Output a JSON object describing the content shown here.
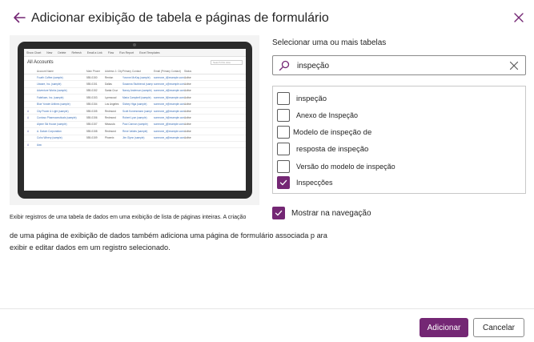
{
  "dialog": {
    "title": "Adicionar exibição de tabela e páginas de formulário"
  },
  "preview": {
    "toolbar": [
      "Show Chart",
      "New",
      "Delete",
      "Refresh",
      "Email a Link",
      "Flow",
      "Run Report",
      "Excel Templates"
    ],
    "view_name": "All Accounts",
    "search_placeholder": "Search this view",
    "columns": [
      "",
      "Account Name",
      "Main Phone",
      "Address 1: City",
      "Primary Contact",
      "Email (Primary Contact)",
      "Status"
    ],
    "rows": [
      [
        "",
        "Fourth Coffee (sample)",
        "555-0150",
        "Renton",
        "Yvonne McKay (sample)",
        "someone_i@example.com",
        "Active"
      ],
      [
        "",
        "Litware, Inc. (sample)",
        "555-0151",
        "Dallas",
        "Susanna Stubberod (samp",
        "someone_c@example.com",
        "Active"
      ],
      [
        "",
        "Adventure Works (sample)",
        "555-0152",
        "Santa Cruz",
        "Nancy Anderson (sample)",
        "someone_d@example.com",
        "Active"
      ],
      [
        "",
        "Fabrikam, Inc. (sample)",
        "555-0153",
        "Lynnwood",
        "Maria Campbell (sample)",
        "someone_f@example.com",
        "Active"
      ],
      [
        "",
        "Blue Yonder Airlines (sample)",
        "555-0154",
        "Los Angeles",
        "Sidney Higa (sample)",
        "someone_e@example.com",
        "Active"
      ],
      [
        "A",
        "City Power & Light (sample)",
        "555-0155",
        "Redmond",
        "Scott Konersmann (sampl",
        "someone_g@example.com",
        "Active"
      ],
      [
        "A",
        "Contoso Pharmaceuticals (sample)",
        "555-0156",
        "Redmond",
        "Robert Lyon (sample)",
        "someone_h@example.com",
        "Active"
      ],
      [
        "",
        "Alpine Ski House (sample)",
        "555-0157",
        "Missoula",
        "Paul Cannon (sample)",
        "someone_j@example.com",
        "Active"
      ],
      [
        "A",
        "A. Datum Corporation",
        "555-0158",
        "Redmond",
        "Rene Valdes (sample)",
        "someone_i@example.com",
        "Active"
      ],
      [
        "",
        "Coho Winery (sample)",
        "555-0159",
        "Phoenix",
        "Jim Glynn (sample)",
        "someone_a@example.com",
        "Active"
      ],
      [
        "A",
        "Aaa",
        "",
        "",
        "",
        "",
        ""
      ]
    ]
  },
  "tables_section": {
    "label": "Selecionar uma ou mais tabelas",
    "search_value": "inspeção",
    "items": [
      {
        "label": "inspeção",
        "checked": false
      },
      {
        "label": "Anexo de Inspeção",
        "checked": false
      },
      {
        "label": "Modelo de inspeção de",
        "checked": false
      },
      {
        "label": "resposta de inspeção",
        "checked": false
      },
      {
        "label": "Versão do modelo de inspeção",
        "checked": false
      },
      {
        "label": "Inspecções",
        "checked": true
      }
    ]
  },
  "navigation": {
    "label": "Mostrar na navegação",
    "checked": true
  },
  "description": {
    "line1": "Exibir registros de uma tabela de dados em uma exibição de lista de páginas inteiras. A criação",
    "line2": "de uma página de exibição de dados também adiciona uma página de formulário associada p ara",
    "line3": "exibir e editar dados em um registro selecionado."
  },
  "footer": {
    "add_label": "Adicionar",
    "cancel_label": "Cancelar"
  },
  "colors": {
    "accent": "#742774",
    "border": "#8a8a8a"
  }
}
